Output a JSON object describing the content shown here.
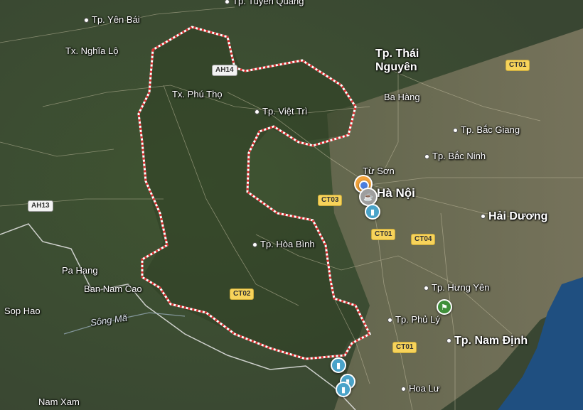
{
  "map": {
    "colors": {
      "terrain": "#3c4a30",
      "plain": "#7a7a5e",
      "sea": "#1f4f80",
      "border": "#ffffff",
      "border_dash": "#d83030"
    },
    "labels": [
      {
        "key": "yen_bai",
        "text": "Tp. Yên Bái",
        "dot": true,
        "big": false
      },
      {
        "key": "tuyen_quang",
        "text": "Tp. Tuyên Quang",
        "dot": true,
        "big": false
      },
      {
        "key": "nghia_lo",
        "text": "Tx. Nghĩa Lộ",
        "dot": false,
        "big": false
      },
      {
        "key": "thai_nguyen",
        "text": "Tp. Thái Nguyên",
        "dot": false,
        "big": true
      },
      {
        "key": "ba_hang",
        "text": "Ba Hàng",
        "dot": false,
        "big": false
      },
      {
        "key": "phu_tho",
        "text": "Tx. Phú Thọ",
        "dot": false,
        "big": false
      },
      {
        "key": "viet_tri",
        "text": "Tp. Việt Trì",
        "dot": true,
        "big": false
      },
      {
        "key": "bac_giang",
        "text": "Tp. Bắc Giang",
        "dot": true,
        "big": false
      },
      {
        "key": "bac_ninh",
        "text": "Tp. Bắc Ninh",
        "dot": true,
        "big": false
      },
      {
        "key": "tu_son",
        "text": "Từ Sơn",
        "dot": false,
        "big": false
      },
      {
        "key": "ha_noi",
        "text": "Hà Nội",
        "dot": false,
        "big": true
      },
      {
        "key": "hai_duong",
        "text": "Hải Dương",
        "dot": true,
        "big": true
      },
      {
        "key": "hoa_binh",
        "text": "Tp. Hòa Bình",
        "dot": true,
        "big": false
      },
      {
        "key": "pa_hang",
        "text": "Pa Hang",
        "dot": false,
        "big": false
      },
      {
        "key": "ban_nam_cao",
        "text": "Ban Nam Cao",
        "dot": false,
        "big": false
      },
      {
        "key": "sop_hao",
        "text": "Sop Hao",
        "dot": false,
        "big": false
      },
      {
        "key": "song_ma",
        "text": "Sông Mã",
        "dot": false,
        "big": false,
        "river": true
      },
      {
        "key": "hung_yen",
        "text": "Tp. Hưng Yên",
        "dot": true,
        "big": false
      },
      {
        "key": "phu_ly",
        "text": "Tp. Phủ Lý",
        "dot": true,
        "big": false
      },
      {
        "key": "nam_dinh",
        "text": "Tp. Nam Định",
        "dot": true,
        "big": true
      },
      {
        "key": "hoa_lu",
        "text": "Hoa Lư",
        "dot": true,
        "big": false
      },
      {
        "key": "nam_xam",
        "text": "Nam Xam",
        "dot": false,
        "big": false
      }
    ],
    "shields": [
      {
        "key": "ah14",
        "text": "AH14",
        "style": "white"
      },
      {
        "key": "ah13",
        "text": "AH13",
        "style": "white"
      },
      {
        "key": "ct01_ne",
        "text": "CT01",
        "style": "yellow"
      },
      {
        "key": "ct03",
        "text": "CT03",
        "style": "yellow"
      },
      {
        "key": "ct01_mid",
        "text": "CT01",
        "style": "yellow"
      },
      {
        "key": "ct04",
        "text": "CT04",
        "style": "yellow"
      },
      {
        "key": "ct02",
        "text": "CT02",
        "style": "yellow"
      },
      {
        "key": "ct01_s",
        "text": "CT01",
        "style": "yellow"
      }
    ],
    "markers": [
      {
        "key": "hanoi_cluster_orange",
        "icon": "fire-icon",
        "color": "orange"
      },
      {
        "key": "hanoi_cluster_blue_dot",
        "icon": "location-dot-icon",
        "color": "bluedot"
      },
      {
        "key": "hanoi_cluster_gray",
        "icon": "coffee-icon",
        "color": "gray"
      },
      {
        "key": "hanoi_bookmark",
        "icon": "bookmark-icon",
        "color": "blue"
      },
      {
        "key": "hung_yen_flag",
        "icon": "flag-icon",
        "color": "green"
      },
      {
        "key": "south_bookmark_1",
        "icon": "bookmark-icon",
        "color": "blue"
      },
      {
        "key": "south_bookmark_2",
        "icon": "bookmark-icon",
        "color": "blue"
      },
      {
        "key": "south_bookmark_3",
        "icon": "bookmark-icon",
        "color": "blue"
      }
    ]
  }
}
